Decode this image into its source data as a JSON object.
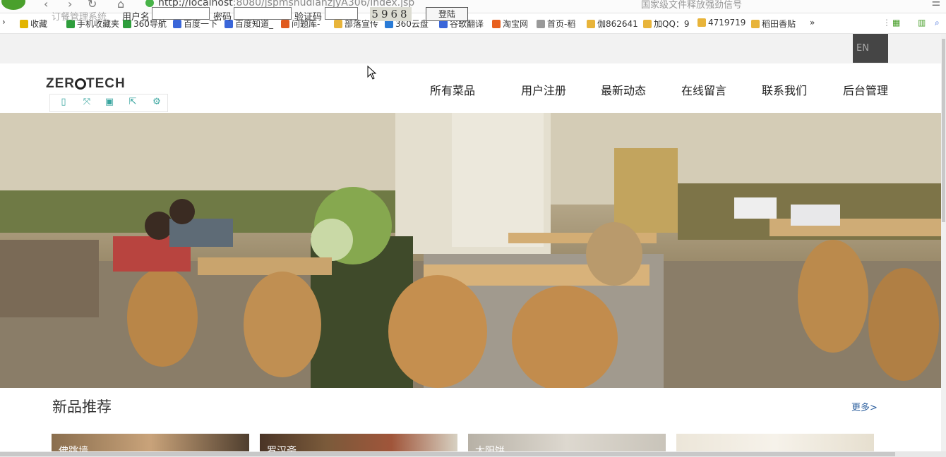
{
  "browser": {
    "url_host": "http://localhost",
    "url_path": ":8080/jspmshudianzjyA306/index.jsp",
    "search_hint": "国家级文件释放强劲信号",
    "bookmarks": [
      {
        "label": "收藏",
        "color": "#e2b400"
      },
      {
        "label": "手机收藏夹",
        "color": "#2e9e3c"
      },
      {
        "label": "360导航",
        "color": "#2e9e3c"
      },
      {
        "label": "百度一下",
        "color": "#3a66d9"
      },
      {
        "label": "百度知道_",
        "color": "#3a66d9"
      },
      {
        "label": "问题库-",
        "color": "#e05a1e"
      },
      {
        "label": "部落宣传",
        "color": "#e8b43a"
      },
      {
        "label": "360云盘",
        "color": "#2a7bd6"
      },
      {
        "label": "谷歌翻译",
        "color": "#3a66d9"
      },
      {
        "label": "淘宝网",
        "color": "#e8601e"
      },
      {
        "label": "首页-稻",
        "color": "#999999"
      },
      {
        "label": "伽862641",
        "color": "#e8b43a"
      },
      {
        "label": "加QQ：9",
        "color": "#e8b43a"
      },
      {
        "label": "4719719",
        "color": "#e8b43a"
      },
      {
        "label": "稻田香贴",
        "color": "#e8b43a"
      }
    ],
    "overflow": "»"
  },
  "login": {
    "system_name": "订餐管理系统",
    "username_label": "用户名",
    "password_label": "密码",
    "captcha_label": "验证码",
    "captcha_code": "5968",
    "login_button": "登陆",
    "lang_button": "EN"
  },
  "header": {
    "logo_left": "ZER",
    "logo_right": "TECH",
    "nav": [
      "所有菜品",
      "用户注册",
      "最新动态",
      "在线留言",
      "联系我们",
      "后台管理"
    ],
    "tools": [
      "▯",
      "⤧",
      "▣",
      "⇱",
      "⚙"
    ]
  },
  "section": {
    "title": "新品推荐",
    "more": "更多>",
    "cards": [
      "佛跳墙",
      "罗汉斋",
      "太阳饼",
      ""
    ]
  }
}
